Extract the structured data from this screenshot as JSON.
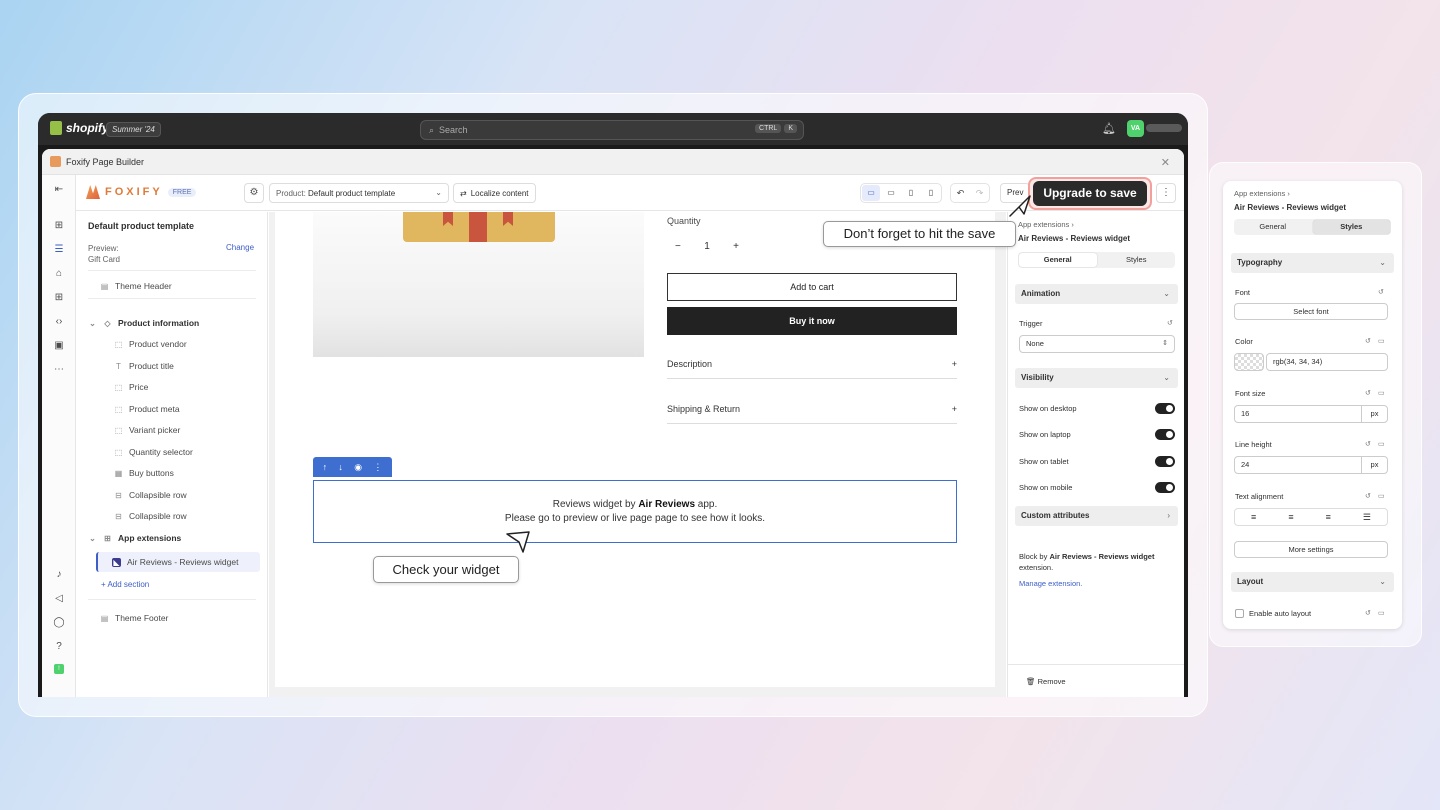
{
  "topbar": {
    "brand": "shopify",
    "edition": "Summer '24",
    "search_placeholder": "Search",
    "shortcut_keys": [
      "CTRL",
      "K"
    ],
    "avatar_initials": "VA"
  },
  "window": {
    "title": "Foxify Page Builder"
  },
  "toolbar": {
    "app_name": "FOXIFY",
    "plan_badge": "FREE",
    "template_prefix": "Product:",
    "template_value": "Default product template",
    "localize_label": "Localize content",
    "preview_label": "Prev",
    "upgrade_label": "Upgrade to save"
  },
  "left_panel": {
    "title": "Default product template",
    "preview_label": "Preview:",
    "preview_value": "Gift Card",
    "change_label": "Change",
    "theme_header": "Theme Header",
    "product_group": "Product information",
    "product_items": [
      "Product vendor",
      "Product title",
      "Price",
      "Product meta",
      "Variant picker",
      "Quantity selector",
      "Buy buttons",
      "Collapsible row",
      "Collapsible row"
    ],
    "app_group": "App extensions",
    "app_item": "Air Reviews - Reviews widget",
    "add_section": "+ Add section",
    "theme_footer": "Theme Footer"
  },
  "canvas": {
    "quantity_label": "Quantity",
    "qty_minus": "−",
    "qty_value": "1",
    "qty_plus": "+",
    "add_to_cart": "Add to cart",
    "buy_now": "Buy it now",
    "accordion": [
      "Description",
      "Shipping & Return"
    ],
    "accordion_icon": "+",
    "widget_line1_pre": "Reviews widget by ",
    "widget_line1_bold": "Air Reviews",
    "widget_line1_post": " app.",
    "widget_line2": "Please go to preview or live page page to see how it looks."
  },
  "callouts": {
    "save": "Don’t forget to hit the save",
    "widget": "Check your widget"
  },
  "right_panel": {
    "breadcrumb": "App extensions",
    "title": "Air Reviews - Reviews widget",
    "tabs": [
      "General",
      "Styles"
    ],
    "active_tab": "General",
    "animation_section": "Animation",
    "trigger_label": "Trigger",
    "trigger_value": "None",
    "visibility_section": "Visibility",
    "visibility_items": [
      "Show on desktop",
      "Show on laptop",
      "Show on tablet",
      "Show on mobile"
    ],
    "custom_section": "Custom attributes",
    "note_pre": "Block by ",
    "note_bold": "Air Reviews - Reviews widget",
    "note_post": " extension.",
    "manage_link": "Manage extension.",
    "remove_label": "Remove"
  },
  "styles_popup": {
    "breadcrumb": "App extensions",
    "title": "Air Reviews - Reviews widget",
    "tabs": [
      "General",
      "Styles"
    ],
    "active_tab": "Styles",
    "typography_section": "Typography",
    "font_label": "Font",
    "font_button": "Select font",
    "color_label": "Color",
    "color_value": "rgb(34, 34, 34)",
    "font_size_label": "Font size",
    "font_size_value": "16",
    "line_height_label": "Line height",
    "line_height_value": "24",
    "unit": "px",
    "text_alignment_label": "Text alignment",
    "more_settings": "More settings",
    "layout_section": "Layout",
    "auto_layout_label": "Enable auto layout"
  },
  "colors": {
    "accent_blue": "#3d6ed0",
    "upgrade_bg": "#2a2a2a",
    "upgrade_ring": "#f2a09b",
    "avatar_green": "#4fd16e"
  }
}
